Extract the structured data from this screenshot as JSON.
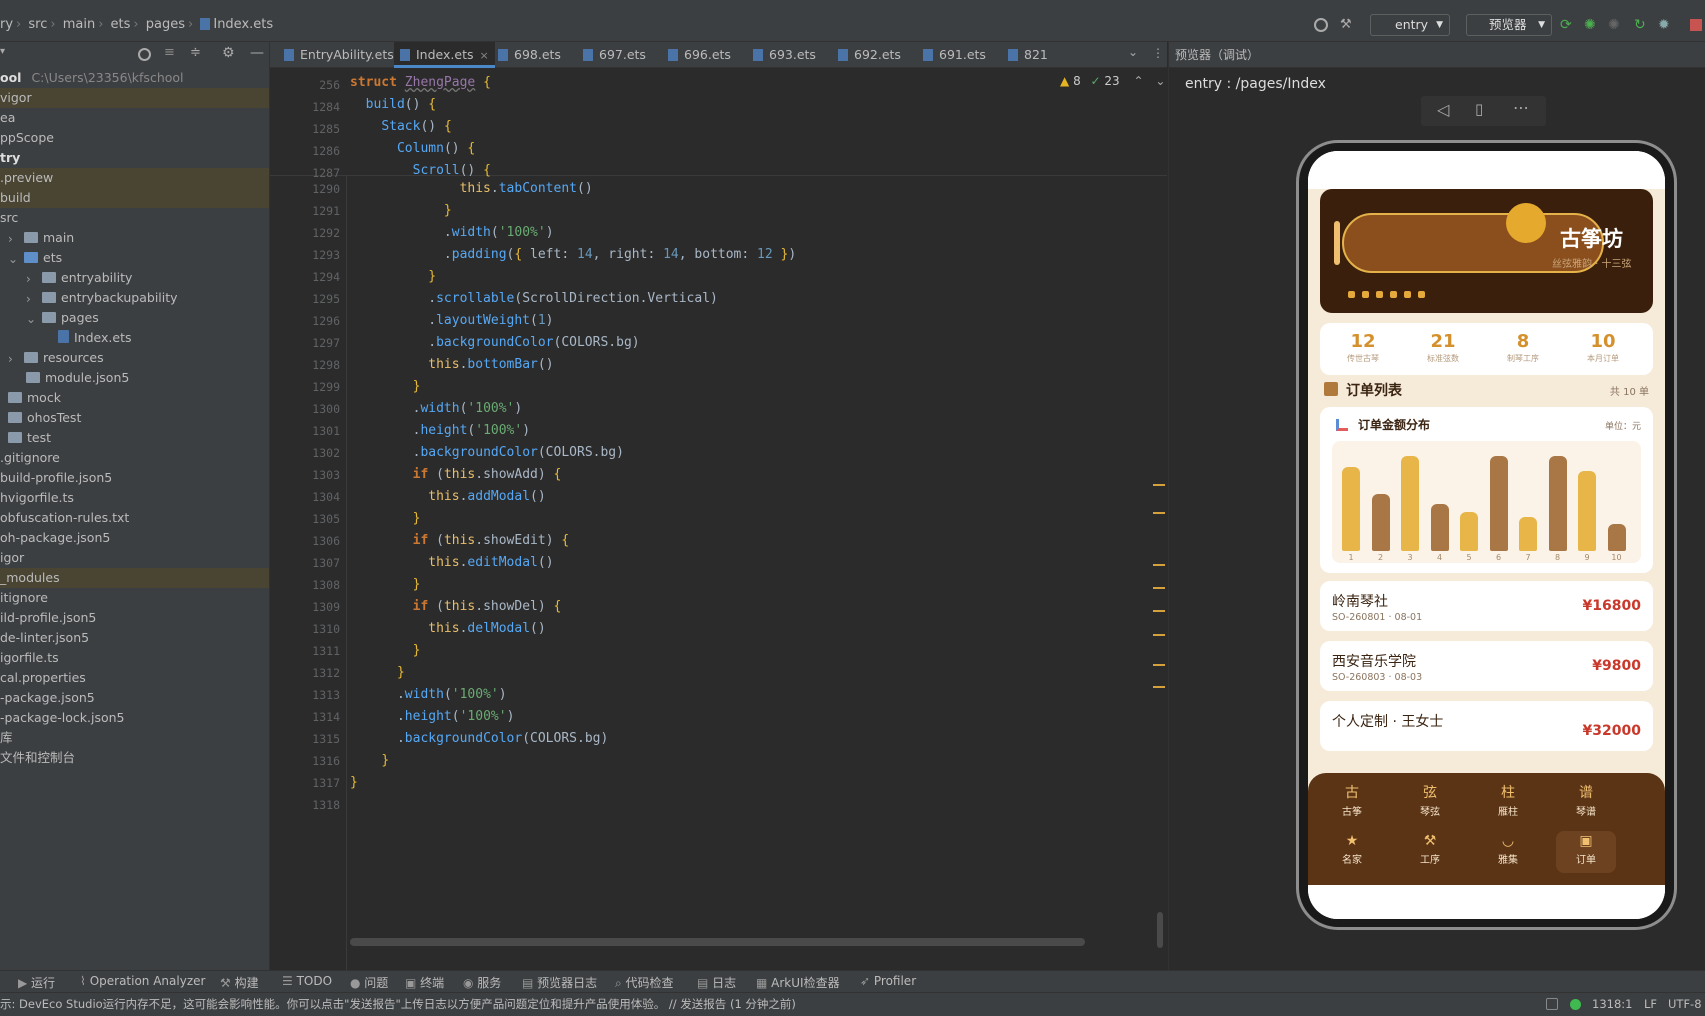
{
  "navbar": {
    "crumbs": [
      "ry",
      "src",
      "main",
      "ets",
      "pages",
      "Index.ets"
    ],
    "run_config": "entry",
    "preview_button": "预览器"
  },
  "project": {
    "root_label": "ool",
    "root_path": "C:\\Users\\23356\\kfschool",
    "items": [
      {
        "label": "vigor",
        "hl": true
      },
      {
        "label": "ea"
      },
      {
        "label": "ppScope"
      },
      {
        "label": "try",
        "bold": true
      },
      {
        "label": ".preview",
        "hl": true
      },
      {
        "label": "build",
        "hl": true
      },
      {
        "label": "src"
      },
      {
        "label": "main"
      },
      {
        "label": "ets"
      },
      {
        "label": "entryability"
      },
      {
        "label": "entrybackupability"
      },
      {
        "label": "pages"
      },
      {
        "label": "Index.ets"
      },
      {
        "label": "resources"
      },
      {
        "label": "module.json5"
      },
      {
        "label": "mock"
      },
      {
        "label": "ohosTest"
      },
      {
        "label": "test"
      },
      {
        "label": ".gitignore"
      },
      {
        "label": "build-profile.json5"
      },
      {
        "label": "hvigorfile.ts"
      },
      {
        "label": "obfuscation-rules.txt"
      },
      {
        "label": "oh-package.json5"
      },
      {
        "label": "igor"
      },
      {
        "label": "_modules",
        "hl": true
      },
      {
        "label": "itignore"
      },
      {
        "label": "ild-profile.json5"
      },
      {
        "label": "de-linter.json5"
      },
      {
        "label": "igorfile.ts"
      },
      {
        "label": "cal.properties"
      },
      {
        "label": "-package.json5"
      },
      {
        "label": "-package-lock.json5"
      },
      {
        "label": "库"
      },
      {
        "label": "文件和控制台"
      }
    ]
  },
  "tabs": [
    "EntryAbility.ets",
    "Index.ets",
    "698.ets",
    "697.ets",
    "696.ets",
    "693.ets",
    "692.ets",
    "691.ets",
    "821"
  ],
  "editor": {
    "warnings": "8",
    "checks": "23",
    "sticky_lines": [
      "256",
      "1284",
      "1285",
      "1286",
      "1287"
    ],
    "line_numbers": [
      "1290",
      "1291",
      "1292",
      "1293",
      "1294",
      "1295",
      "1296",
      "1297",
      "1298",
      "1299",
      "1300",
      "1301",
      "1302",
      "1303",
      "1304",
      "1305",
      "1306",
      "1307",
      "1308",
      "1309",
      "1310",
      "1311",
      "1312",
      "1313",
      "1314",
      "1315",
      "1316",
      "1317",
      "1318"
    ]
  },
  "preview": {
    "header": "预览器（调试）",
    "route": "entry : /pages/Index",
    "app": {
      "hero_title": "古筝坊",
      "hero_subtitle": "丝弦雅韵 · 十三弦",
      "stats": [
        {
          "value": "12",
          "label": "传世古琴"
        },
        {
          "value": "21",
          "label": "标准弦数"
        },
        {
          "value": "8",
          "label": "制琴工序"
        },
        {
          "value": "10",
          "label": "本月订单"
        }
      ],
      "order_list_title": "订单列表",
      "order_count": "共 10 单",
      "chart_title": "订单金额分布",
      "chart_unit": "单位：元",
      "orders": [
        {
          "name": "岭南琴社",
          "sub": "SO-260801 · 08-01",
          "amount": "¥16800"
        },
        {
          "name": "西安音乐学院",
          "sub": "SO-260803 · 08-03",
          "amount": "¥9800"
        },
        {
          "name": "个人定制 · 王女士",
          "sub": "",
          "amount": "¥32000"
        }
      ],
      "nav": [
        {
          "icon": "古",
          "label": "古筝"
        },
        {
          "icon": "弦",
          "label": "琴弦"
        },
        {
          "icon": "柱",
          "label": "雁柱"
        },
        {
          "icon": "谱",
          "label": "琴谱"
        },
        {
          "icon": "★",
          "label": "名家"
        },
        {
          "icon": "⚒",
          "label": "工序"
        },
        {
          "icon": "◡",
          "label": "雅集"
        },
        {
          "icon": "▣",
          "label": "订单"
        }
      ]
    }
  },
  "chart_data": {
    "type": "bar",
    "categories": [
      "1",
      "2",
      "3",
      "4",
      "5",
      "6",
      "7",
      "8",
      "9",
      "10"
    ],
    "values": [
      16800,
      11500,
      19000,
      9500,
      7800,
      19000,
      6800,
      19000,
      16000,
      5400
    ],
    "title": "订单金额分布",
    "xlabel": "",
    "ylabel": "",
    "ylim": [
      0,
      20000
    ]
  },
  "bottom_tools": [
    "运行",
    "Operation Analyzer",
    "构建",
    "TODO",
    "问题",
    "终端",
    "服务",
    "预览器日志",
    "代码检查",
    "日志",
    "ArkUI检查器",
    "Profiler"
  ],
  "status": {
    "message": "示: DevEco Studio运行内存不足，这可能会影响性能。你可以点击\"发送报告\"上传日志以方便产品问题定位和提升产品使用体验。 // 发送报告 (1 分钟之前)",
    "position": "1318:1",
    "line_sep": "LF",
    "encoding": "UTF-8"
  }
}
